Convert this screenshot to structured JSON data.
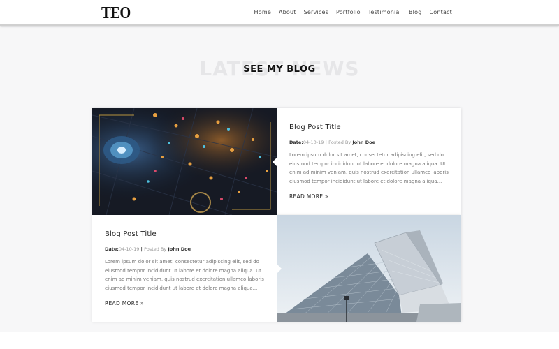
{
  "header": {
    "logo": "TEO",
    "nav": [
      "Home",
      "About",
      "Services",
      "Portfolio",
      "Testimonial",
      "Blog",
      "Contact"
    ]
  },
  "section": {
    "heading_bg": "LATEST NEWS",
    "heading_fg": "SEE MY BLOG"
  },
  "posts": [
    {
      "title": "Blog Post Title",
      "date_label": "Date:",
      "date": "04-10-19",
      "posted_by_label": "Posted By",
      "author": "John Doe",
      "excerpt": "Lorem ipsum dolor sit amet, consectetur adipiscing elit, sed do eiusmod tempor incididunt ut labore et dolore magna aliqua. Ut enim ad minim veniam, quis nostrud exercitation ullamco laboris eiusmod tempor incididunt ut labore et dolore magna aliqua...",
      "read_more": "READ MORE »",
      "image": "night-fair-aerial-photo"
    },
    {
      "title": "Blog Post Title",
      "date_label": "Date:",
      "date": "04-10-19",
      "posted_by_label": "Posted By",
      "author": "John Doe",
      "excerpt": "Lorem ipsum dolor sit amet, consectetur adipiscing elit, sed do eiusmod tempor incididunt ut labore et dolore magna aliqua. Ut enim ad minim veniam, quis nostrud exercitation ullamco laboris eiusmod tempor incididunt ut labore et dolore magna aliqua...",
      "read_more": "READ MORE »",
      "image": "modern-glass-building-photo"
    }
  ],
  "colors": {
    "background": "#f7f7f8",
    "text": "#333333",
    "muted": "#777777",
    "heading_ghost": "#e6e6e8"
  }
}
